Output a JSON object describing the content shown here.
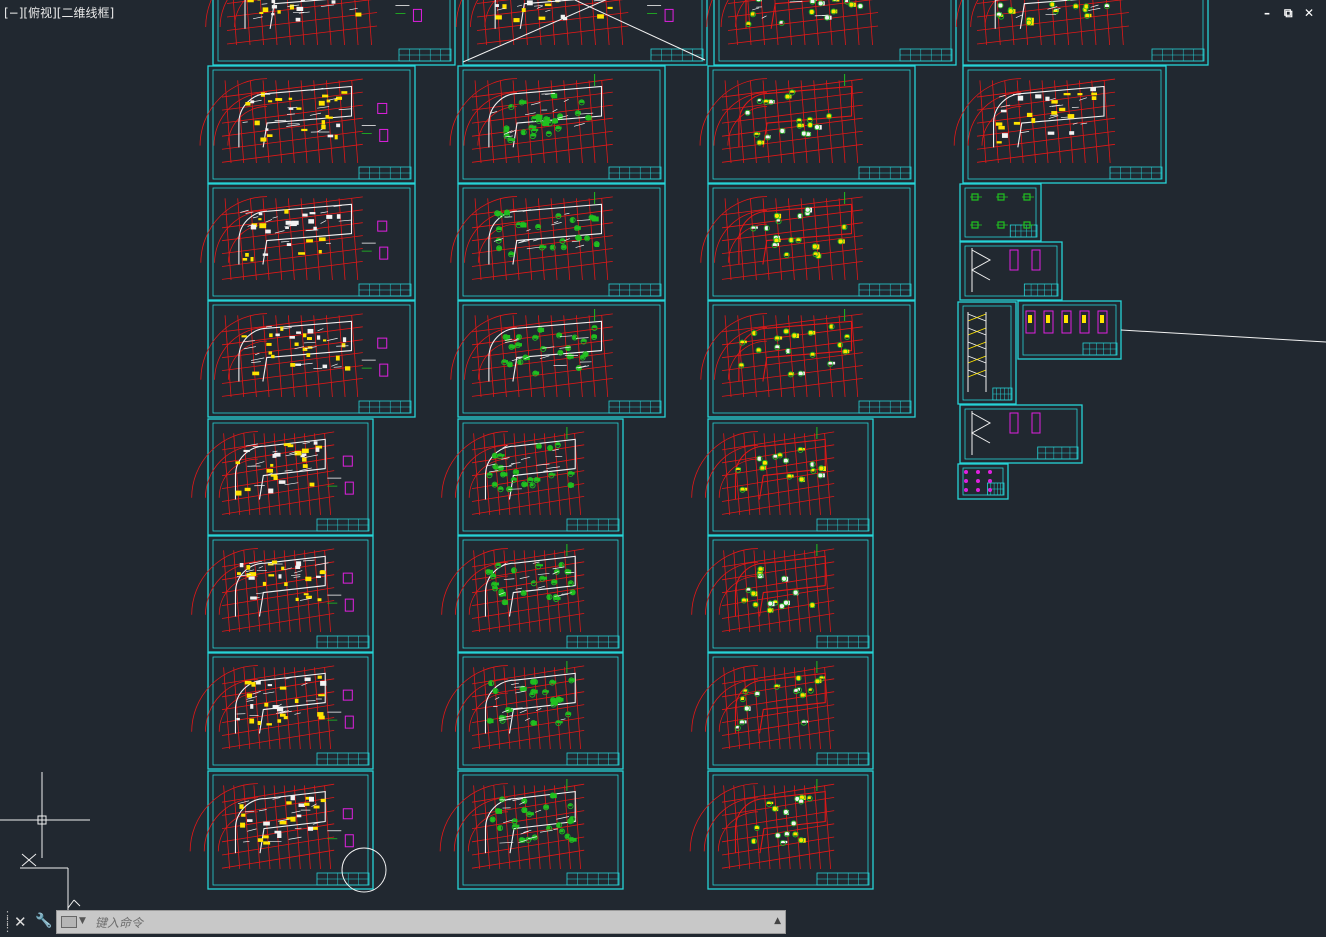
{
  "viewport": {
    "label": "[−][俯视][二维线框]",
    "background": "#212830"
  },
  "window_controls": {
    "minimize": "–",
    "restore": "⧉",
    "close": "✕"
  },
  "command_line": {
    "placeholder": "键入命令",
    "close_icon": "✕",
    "customize_icon": "wrench-icon",
    "prompt_icon": "command-prompt-icon",
    "history_icon": "chevron-up-icon"
  },
  "colors": {
    "sheet_border": "#27d3d6",
    "grid_line": "#e01818",
    "wall": "#f2f2f2",
    "column": "#ffe400",
    "annotation": "#e020e0",
    "detail_green": "#20c020",
    "ucs": "#f0f0f0"
  },
  "icons": {
    "ucs": "ucs-axis-icon",
    "crosshair": "crosshair-cursor-icon"
  }
}
